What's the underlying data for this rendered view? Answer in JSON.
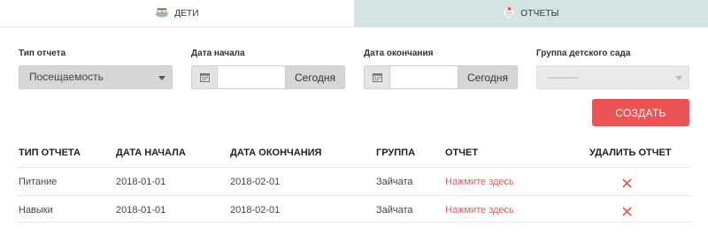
{
  "tabs": [
    {
      "label": "ДЕТИ",
      "icon": "kids-icon",
      "active": false
    },
    {
      "label": "ОТЧЕТЫ",
      "icon": "report-icon",
      "active": true
    }
  ],
  "filters": {
    "report_type": {
      "label": "Тип отчета",
      "value": "Посещаемость"
    },
    "start_date": {
      "label": "Дата начала",
      "value": "",
      "today_label": "Сегодня"
    },
    "end_date": {
      "label": "Дата окончания",
      "value": "",
      "today_label": "Сегодня"
    },
    "group": {
      "label": "Группа детского сада",
      "value": "———"
    }
  },
  "create_button": "СОЗДАТЬ",
  "table": {
    "columns": [
      "ТИП ОТЧЕТА",
      "ДАТА НАЧАЛА",
      "ДАТА ОКОНЧАНИЯ",
      "ГРУППА",
      "ОТЧЕТ",
      "УДАЛИТЬ ОТЧЕТ"
    ],
    "rows": [
      {
        "type": "Питание",
        "start": "2018-01-01",
        "end": "2018-02-01",
        "group": "Зайчата",
        "report": "Нажмите здесь"
      },
      {
        "type": "Навыки",
        "start": "2018-01-01",
        "end": "2018-02-01",
        "group": "Зайчата",
        "report": "Нажмите здесь"
      }
    ]
  },
  "colors": {
    "accent": "#ea5455",
    "active_tab": "#d3e3e4",
    "link": "#ea5a5a"
  }
}
